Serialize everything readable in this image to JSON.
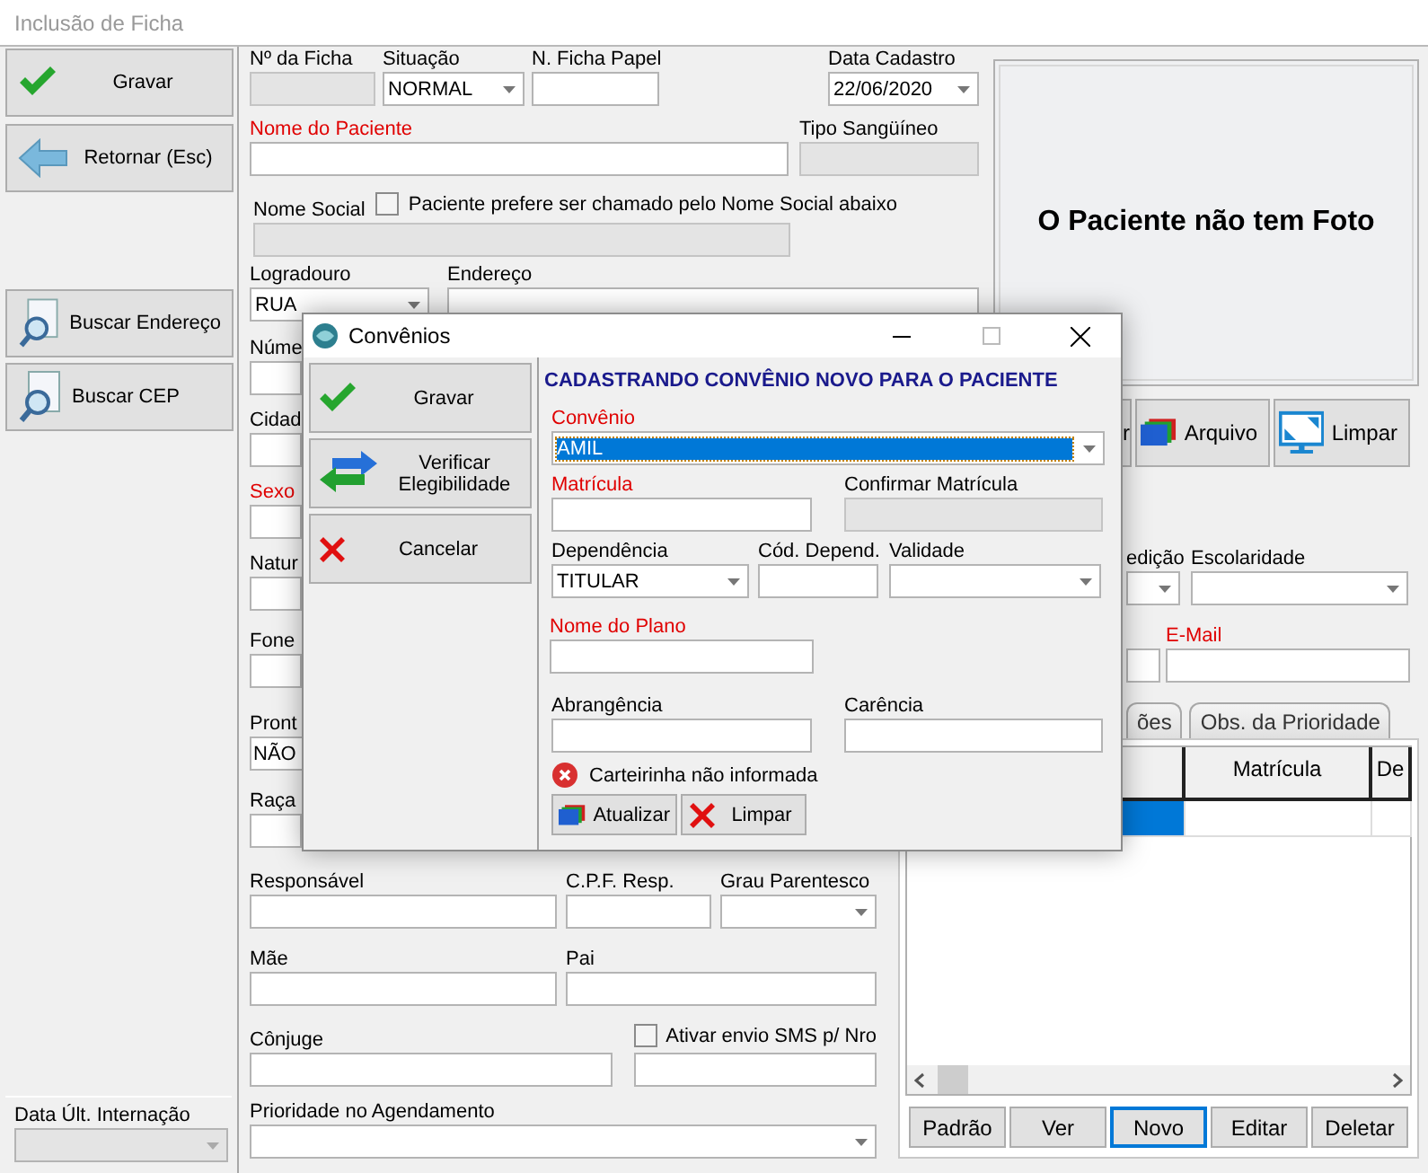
{
  "window": {
    "title": "Inclusão de Ficha"
  },
  "sidebar": {
    "buttons": [
      {
        "label": "Gravar",
        "kind": "check"
      },
      {
        "label": "Retornar (Esc)",
        "kind": "arrow"
      },
      {
        "label": "Buscar Endereço",
        "kind": "search"
      },
      {
        "label": "Buscar CEP",
        "kind": "search"
      }
    ],
    "last_admission": {
      "label": "Data Últ. Internação",
      "kind": "combo",
      "disabled": true
    }
  },
  "form": {
    "ficha_no": {
      "label": "Nº da Ficha",
      "kind": "text",
      "disabled": true
    },
    "situacao": {
      "label": "Situação",
      "kind": "combo",
      "value": "NORMAL"
    },
    "ficha_papel": {
      "label": "N. Ficha Papel",
      "kind": "text"
    },
    "data_cadastro": {
      "label": "Data Cadastro",
      "kind": "combo",
      "value": "22/06/2020"
    },
    "nome_paciente": {
      "label": "Nome do Paciente",
      "kind": "text",
      "required": true
    },
    "tipo_sanguineo": {
      "label": "Tipo Sangüíneo",
      "kind": "text",
      "disabled": true
    },
    "nome_social": {
      "label": "Nome Social",
      "kind": "text",
      "disabled": true
    },
    "prefere_nome_social": {
      "label": "Paciente prefere ser chamado pelo Nome Social abaixo",
      "checked": false
    },
    "logradouro": {
      "label": "Logradouro",
      "kind": "combo",
      "value": "RUA"
    },
    "endereco": {
      "label": "Endereço",
      "kind": "text"
    },
    "numero": {
      "label": "Núme",
      "kind": "text"
    },
    "cidade": {
      "label": "Cidad",
      "kind": "text"
    },
    "sexo": {
      "label": "Sexo",
      "kind": "text",
      "required": true
    },
    "naturalidade": {
      "label": "Natur",
      "kind": "text"
    },
    "fone": {
      "label": "Fone",
      "kind": "text"
    },
    "prontuario": {
      "label": "Pront",
      "kind": "text",
      "value": "NÃO"
    },
    "raca": {
      "label": "Raça",
      "kind": "text"
    },
    "responsavel": {
      "label": "Responsável",
      "kind": "text"
    },
    "cpf_resp": {
      "label": "C.P.F. Resp.",
      "kind": "text"
    },
    "grau_parentesco": {
      "label": "Grau Parentesco",
      "kind": "combo"
    },
    "mae": {
      "label": "Mãe",
      "kind": "text"
    },
    "pai": {
      "label": "Pai",
      "kind": "text"
    },
    "conjuge": {
      "label": "Cônjuge",
      "kind": "text"
    },
    "sms": {
      "label": "Ativar envio SMS p/ Nro",
      "checked": false
    },
    "sms_numero": {
      "kind": "text"
    },
    "prioridade": {
      "label": "Prioridade no Agendamento",
      "kind": "combo"
    }
  },
  "photo": {
    "message": "O Paciente não tem Foto"
  },
  "toolbar": [
    {
      "label": "r",
      "kind": "partial"
    },
    {
      "label": "Arquivo",
      "kind": "cards"
    },
    {
      "label": "Limpar",
      "kind": "monitor"
    }
  ],
  "right_fields": {
    "edicao": {
      "label": "edição",
      "kind": "combo"
    },
    "escolaridade": {
      "label": "Escolaridade",
      "kind": "combo"
    },
    "email_prev": {
      "kind": "text"
    },
    "email": {
      "label": "E-Mail",
      "kind": "text",
      "required": true
    }
  },
  "tabs": [
    {
      "label": "ões",
      "selected": false
    },
    {
      "label": "Obs. da Prioridade",
      "selected": false
    }
  ],
  "grid": {
    "columns": [
      {
        "label": "Matrícula"
      },
      {
        "label": "De"
      }
    ],
    "rows": [
      {
        "selected": true
      }
    ],
    "buttons": [
      {
        "label": "Padrão",
        "focused": false
      },
      {
        "label": "Ver",
        "focused": false
      },
      {
        "label": "Novo",
        "focused": true
      },
      {
        "label": "Editar",
        "focused": false
      },
      {
        "label": "Deletar",
        "focused": false
      }
    ]
  },
  "dialog": {
    "title": "Convênios",
    "buttons": [
      {
        "label": "Gravar",
        "kind": "check"
      },
      {
        "label": "Verificar Elegibilidade",
        "kind": "swap"
      },
      {
        "label": "Cancelar",
        "kind": "cross"
      }
    ],
    "heading": "CADASTRANDO CONVÊNIO NOVO PARA O PACIENTE",
    "fields": {
      "convenio": {
        "label": "Convênio",
        "kind": "combo",
        "value": "AMIL",
        "required": true,
        "highlighted": true
      },
      "matricula": {
        "label": "Matrícula",
        "kind": "text",
        "required": true
      },
      "confirmar": {
        "label": "Confirmar Matrícula",
        "kind": "text",
        "disabled": true
      },
      "dependencia": {
        "label": "Dependência",
        "kind": "combo",
        "value": "TITULAR"
      },
      "cod_depend": {
        "label": "Cód. Depend.",
        "kind": "text"
      },
      "validade": {
        "label": "Validade",
        "kind": "combo"
      },
      "nome_plano": {
        "label": "Nome do Plano",
        "kind": "text",
        "required": true
      },
      "abrangencia": {
        "label": "Abrangência",
        "kind": "text"
      },
      "carencia": {
        "label": "Carência",
        "kind": "text"
      }
    },
    "card_status": {
      "message": "Carteirinha não informada"
    },
    "actions": [
      {
        "label": "Atualizar",
        "kind": "cards"
      },
      {
        "label": "Limpar",
        "kind": "cross"
      }
    ]
  }
}
